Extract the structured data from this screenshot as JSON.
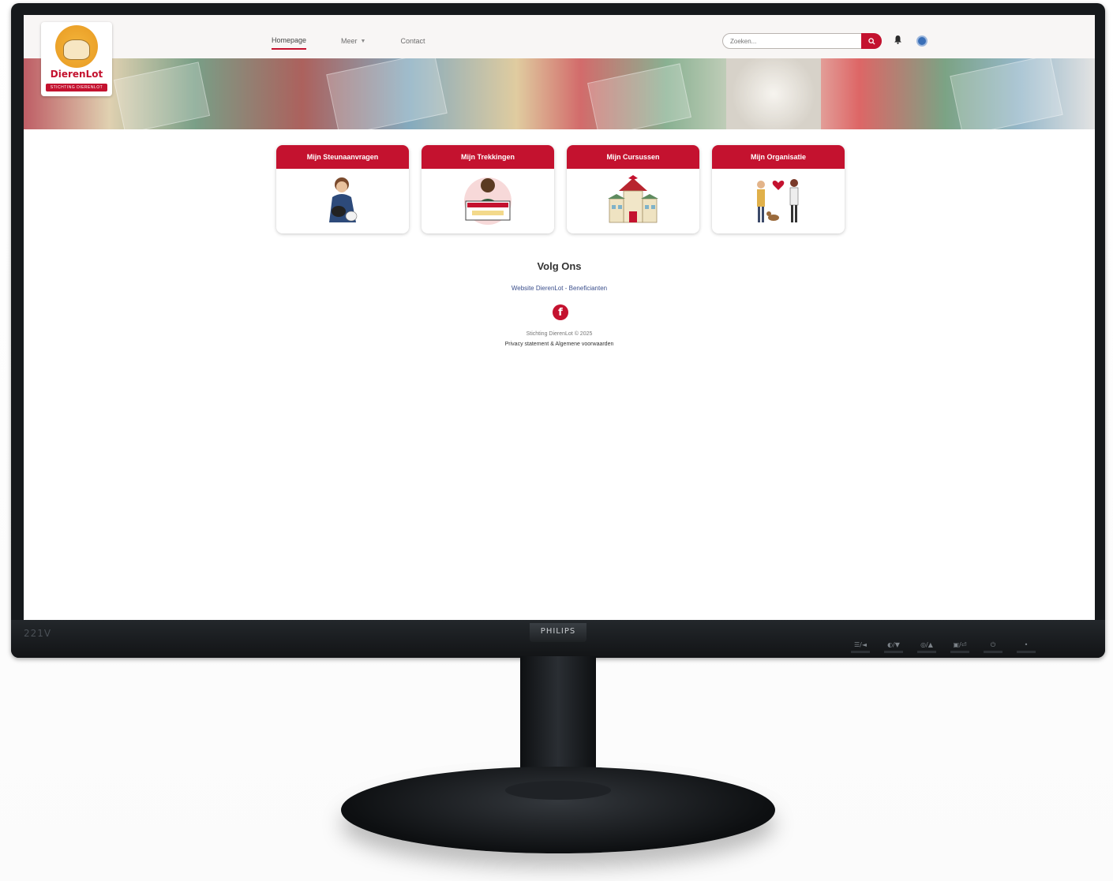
{
  "monitor": {
    "model": "221V",
    "brand": "PHILIPS",
    "controls": [
      "☰/◄",
      "◐/▼",
      "◎/▲",
      "▣/⏎",
      "⏻",
      "•"
    ]
  },
  "header": {
    "nav": [
      {
        "label": "Homepage"
      },
      {
        "label": "Meer"
      },
      {
        "label": "Contact"
      }
    ],
    "search_placeholder": "Zoeken...",
    "search_icon": "magnifier-icon",
    "bell_icon": "bell-icon",
    "user_icon": "user-avatar-icon"
  },
  "logo": {
    "name": "DierenLot",
    "tag": "STICHTING DIERENLOT"
  },
  "tiles": [
    {
      "label": "Mijn Steunaanvragen",
      "icon": "person-with-pets-illustration"
    },
    {
      "label": "Mijn Trekkingen",
      "icon": "winner-cheque-illustration"
    },
    {
      "label": "Mijn Cursussen",
      "icon": "school-building-illustration"
    },
    {
      "label": "Mijn Organisatie",
      "icon": "people-heart-dog-illustration"
    }
  ],
  "footer": {
    "title": "Volg Ons",
    "link": "Website DierenLot - Beneficianten",
    "copyright": "Stichting DierenLot © 2025",
    "privacy": "Privacy statement & Algemene voorwaarden"
  },
  "colors": {
    "accent": "#c4122f",
    "user": "#3a6fb7"
  }
}
